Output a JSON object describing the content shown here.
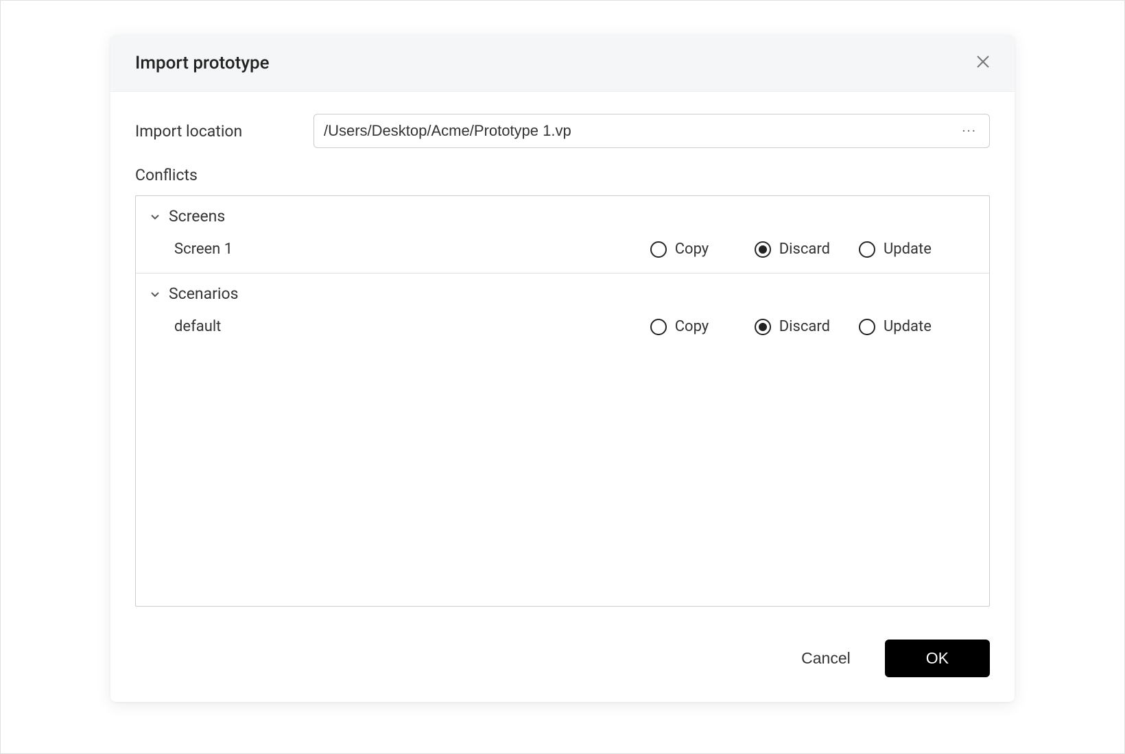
{
  "dialog": {
    "title": "Import prototype",
    "import_location_label": "Import location",
    "import_location_value": "/Users/Desktop/Acme/Prototype 1.vp",
    "conflicts_label": "Conflicts",
    "options": {
      "copy": "Copy",
      "discard": "Discard",
      "update": "Update"
    },
    "groups": [
      {
        "name": "Screens",
        "items": [
          {
            "name": "Screen 1",
            "selected": "discard"
          }
        ]
      },
      {
        "name": "Scenarios",
        "items": [
          {
            "name": "default",
            "selected": "discard"
          }
        ]
      }
    ],
    "footer": {
      "cancel": "Cancel",
      "ok": "OK"
    }
  }
}
